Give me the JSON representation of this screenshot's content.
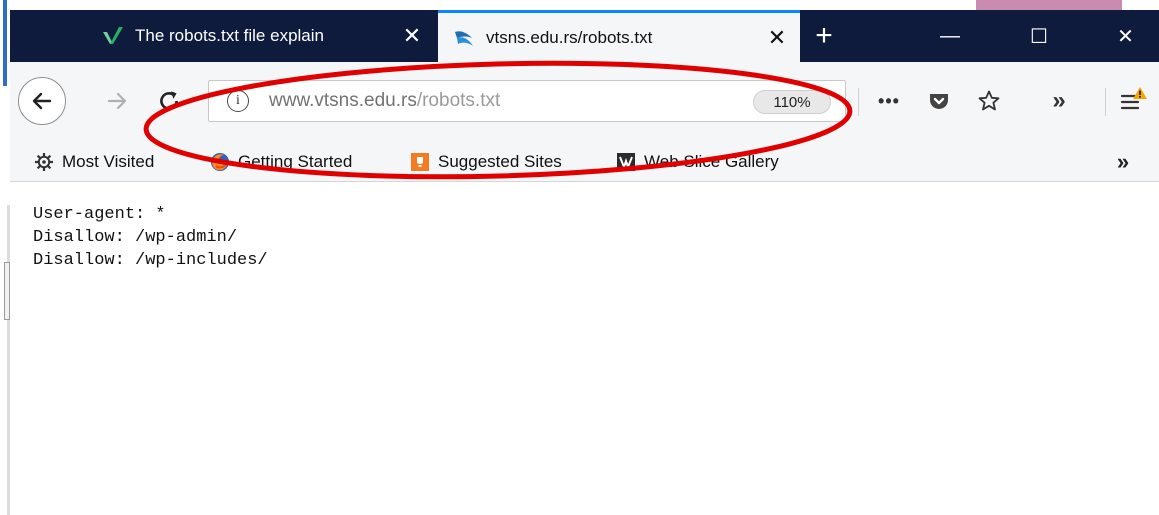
{
  "tabs": [
    {
      "title": "The robots.txt file explain",
      "close": "✕",
      "active": false,
      "icon": "vee-logo-icon"
    },
    {
      "title": "vtsns.edu.rs/robots.txt",
      "close": "✕",
      "active": true,
      "icon": "site-favicon-icon"
    }
  ],
  "titlebar": {
    "new_tab": "+",
    "minimize": "—",
    "maximize": "☐",
    "close": "✕"
  },
  "nav": {
    "url_host": "www.vtsns.edu.rs",
    "url_path": "/robots.txt",
    "zoom": "110%",
    "page_actions": "•••",
    "overflow": "»",
    "info": "i"
  },
  "bookmarks": [
    {
      "label": "Most Visited",
      "icon": "gear-icon"
    },
    {
      "label": "Getting Started",
      "icon": "firefox-icon"
    },
    {
      "label": "Suggested Sites",
      "icon": "suggested-sites-icon"
    },
    {
      "label": "Web Slice Gallery",
      "icon": "web-slice-icon"
    }
  ],
  "bookmarks_more": "»",
  "content": {
    "lines": [
      "User-agent: *",
      "Disallow: /wp-admin/",
      "Disallow: /wp-includes/"
    ]
  },
  "colors": {
    "titlebar": "#0f1b3d",
    "toolbar": "#f5f6f7",
    "annotation": "#e00000",
    "tab_accent": "#0a84ff"
  }
}
